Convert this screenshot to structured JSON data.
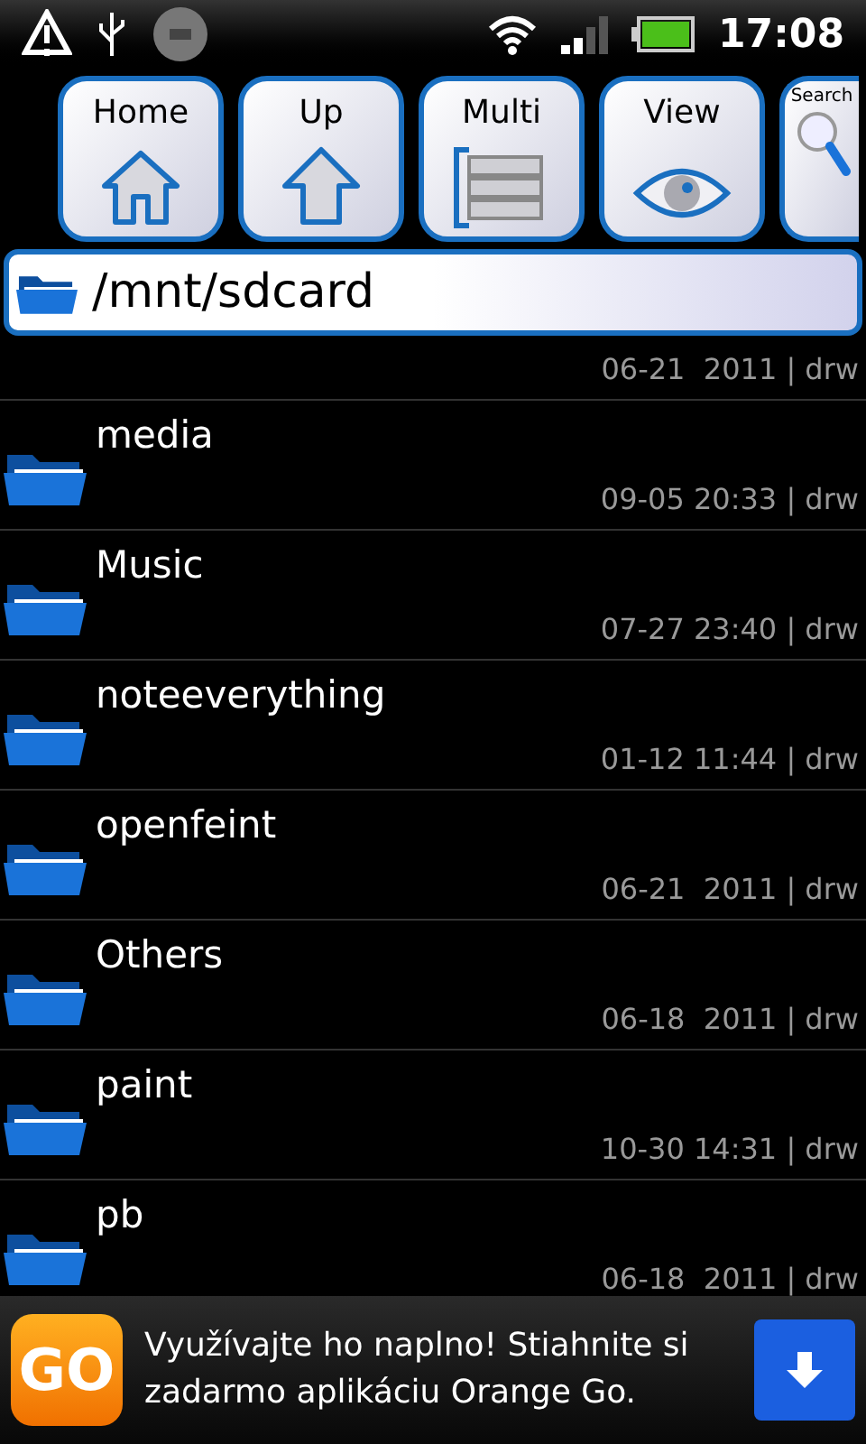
{
  "status_bar": {
    "time": "17:08"
  },
  "toolbar": [
    {
      "label": "Home",
      "kind": "home"
    },
    {
      "label": "Up",
      "kind": "up"
    },
    {
      "label": "Multi",
      "kind": "multi"
    },
    {
      "label": "View",
      "kind": "view"
    },
    {
      "label": "Search",
      "kind": "search"
    }
  ],
  "path_bar": {
    "path": "/mnt/sdcard"
  },
  "partial_row": {
    "meta": "06-21  2011 | drw"
  },
  "files": [
    {
      "name": "media",
      "meta": "09-05 20:33 | drw"
    },
    {
      "name": "Music",
      "meta": "07-27 23:40 | drw"
    },
    {
      "name": "noteeverything",
      "meta": "01-12 11:44 | drw"
    },
    {
      "name": "openfeint",
      "meta": "06-21  2011 | drw"
    },
    {
      "name": "Others",
      "meta": "06-18  2011 | drw"
    },
    {
      "name": "paint",
      "meta": "10-30 14:31 | drw"
    },
    {
      "name": "pb",
      "meta": "06-18  2011 | drw"
    }
  ],
  "ad": {
    "logo_text": "GO",
    "text": "Využívajte ho naplno! Stiahnite si zadarmo aplikáciu Orange Go."
  }
}
